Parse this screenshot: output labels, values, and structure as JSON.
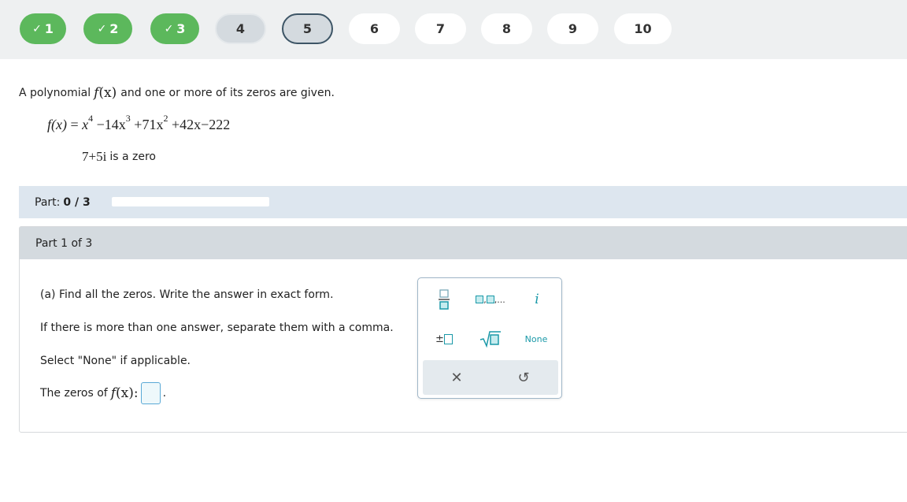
{
  "nav": {
    "questions": [
      {
        "label": "1",
        "state": "done",
        "check": "✓"
      },
      {
        "label": "2",
        "state": "done",
        "check": "✓"
      },
      {
        "label": "3",
        "state": "done",
        "check": "✓"
      },
      {
        "label": "4",
        "state": "visited"
      },
      {
        "label": "5",
        "state": "current"
      },
      {
        "label": "6",
        "state": "unvisited"
      },
      {
        "label": "7",
        "state": "unvisited"
      },
      {
        "label": "8",
        "state": "unvisited"
      },
      {
        "label": "9",
        "state": "unvisited"
      },
      {
        "label": "10",
        "state": "unvisited"
      }
    ]
  },
  "problem": {
    "intro_before": "A polynomial",
    "fx": "f",
    "fx_arg": "(x)",
    "intro_after": "and one or more of its zeros are given.",
    "polynomial": {
      "lhs": "f(x)",
      "eq": "=",
      "t1": "x",
      "t1_exp": "4",
      "t2": "−14x",
      "t2_exp": "3",
      "t3": "+71x",
      "t3_exp": "2",
      "t4": "+42x−222"
    },
    "zero_value": "7+5i",
    "zero_text": "is a zero"
  },
  "progress": {
    "label": "Part:",
    "value": "0 / 3",
    "fraction": 0
  },
  "part": {
    "header": "Part 1 of 3",
    "instruction": "(a) Find all the zeros. Write the answer in exact form.",
    "separator_note": "If there is more than one answer, separate them with a comma.",
    "none_note": "Select \"None\" if applicable.",
    "answer_prefix": "The zeros of",
    "answer_fx": "f",
    "answer_arg": "(x):",
    "answer_suffix": "."
  },
  "keypad": {
    "fraction_key": "fraction-icon",
    "list_key_dots": ",...",
    "imag_key": "i",
    "plusminus_key": "±",
    "sqrt_key": "sqrt-icon",
    "none_key": "None",
    "clear_key": "✕",
    "undo_key": "↺",
    "accent_color": "#1a99a8"
  }
}
